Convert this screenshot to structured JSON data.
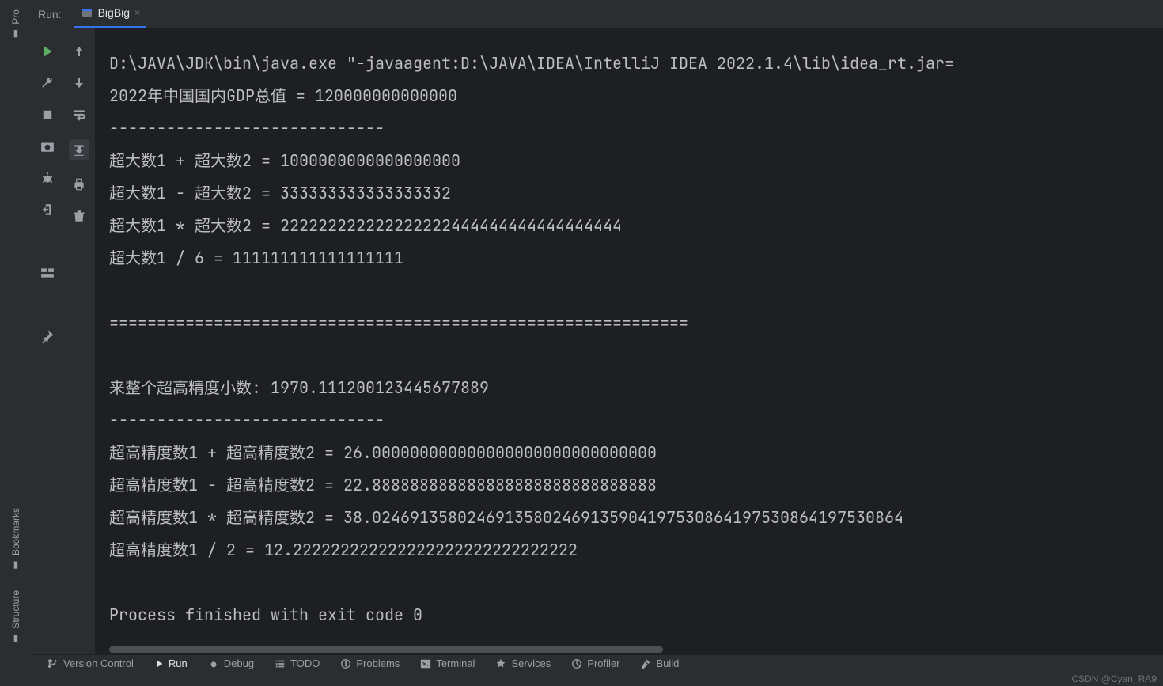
{
  "leftRail": {
    "project": "Pro",
    "bookmarks": "Bookmarks",
    "structure": "Structure"
  },
  "tabbar": {
    "runLabel": "Run:",
    "tabName": "BigBig",
    "closeGlyph": "×"
  },
  "console": {
    "lines": [
      "D:\\JAVA\\JDK\\bin\\java.exe \"-javaagent:D:\\JAVA\\IDEA\\IntelliJ IDEA 2022.1.4\\lib\\idea_rt.jar=",
      "2022年中国国内GDP总值 = 120000000000000",
      "-----------------------------",
      "超大数1 + 超大数2 = 1000000000000000000",
      "超大数1 - 超大数2 = 333333333333333332",
      "超大数1 * 超大数2 = 222222222222222222444444444444444444",
      "超大数1 / 6 = 111111111111111111",
      "",
      "=============================================================",
      "",
      "来整个超高精度小数: 1970.111200123445677889",
      "-----------------------------",
      "超高精度数1 + 超高精度数2 = 26.000000000000000000000000000000",
      "超高精度数1 - 超高精度数2 = 22.888888888888888888888888888888",
      "超高精度数1 * 超高精度数2 = 38.02469135802469135802469135904197530864197530864197530864",
      "超高精度数1 / 2 = 12.222222222222222222222222222222",
      "",
      "Process finished with exit code 0"
    ]
  },
  "bottombar": {
    "versionControl": "Version Control",
    "run": "Run",
    "debug": "Debug",
    "todo": "TODO",
    "problems": "Problems",
    "terminal": "Terminal",
    "services": "Services",
    "profiler": "Profiler",
    "build": "Build"
  },
  "watermark": "CSDN @Cyan_RA9"
}
